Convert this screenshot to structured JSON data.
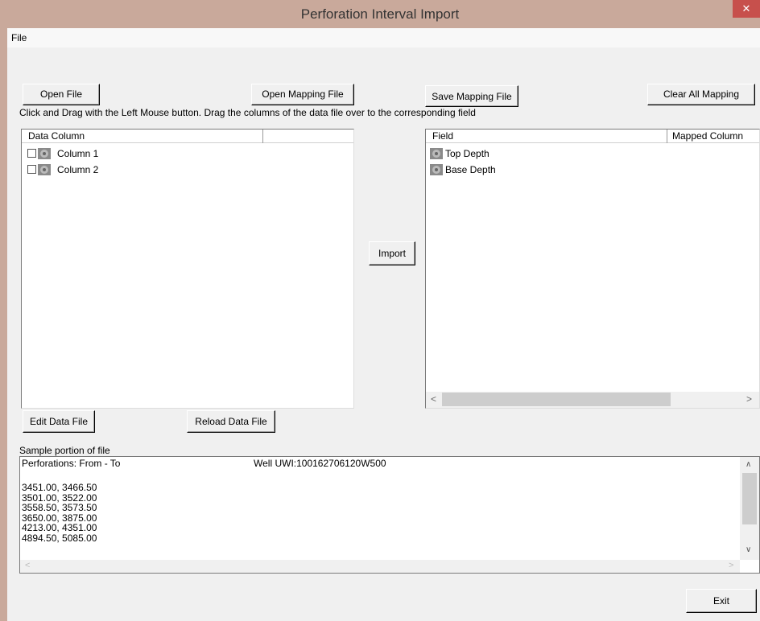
{
  "window": {
    "title": "Perforation Interval Import",
    "close_glyph": "✕"
  },
  "menu": {
    "file_label": "File"
  },
  "toolbar": {
    "open_file": "Open File",
    "open_mapping_file": "Open Mapping File",
    "save_mapping_file": "Save Mapping File",
    "clear_all_mapping": "Clear All Mapping"
  },
  "instruction_text": "Click and Drag with the Left Mouse button. Drag the columns of the data file over to the corresponding field",
  "data_columns": {
    "header": "Data Column",
    "items": [
      {
        "label": "Column 1",
        "checked": false
      },
      {
        "label": "Column 2",
        "checked": false
      }
    ]
  },
  "import_button": "Import",
  "fields": {
    "header_field": "Field",
    "header_mapped": "Mapped Column",
    "items": [
      {
        "label": "Top Depth"
      },
      {
        "label": "Base Depth"
      }
    ]
  },
  "edit_data_file": "Edit Data File",
  "reload_data_file": "Reload Data File",
  "sample": {
    "label": "Sample portion of file",
    "header_left": "Perforations: From - To",
    "header_right": "Well UWI:100162706120W500",
    "lines": [
      "3451.00, 3466.50",
      "3501.00, 3522.00",
      "3558.50, 3573.50",
      "3650.00, 3875.00",
      "4213.00, 4351.00",
      "4894.50, 5085.00"
    ]
  },
  "exit_button": "Exit",
  "icons": {
    "close": "close-icon",
    "checkbox": "checkbox-icon",
    "column": "gear-icon",
    "scroll_left": "scroll-left-arrow",
    "scroll_right": "scroll-right-arrow",
    "scroll_up": "scroll-up-arrow",
    "scroll_down": "scroll-down-arrow"
  }
}
